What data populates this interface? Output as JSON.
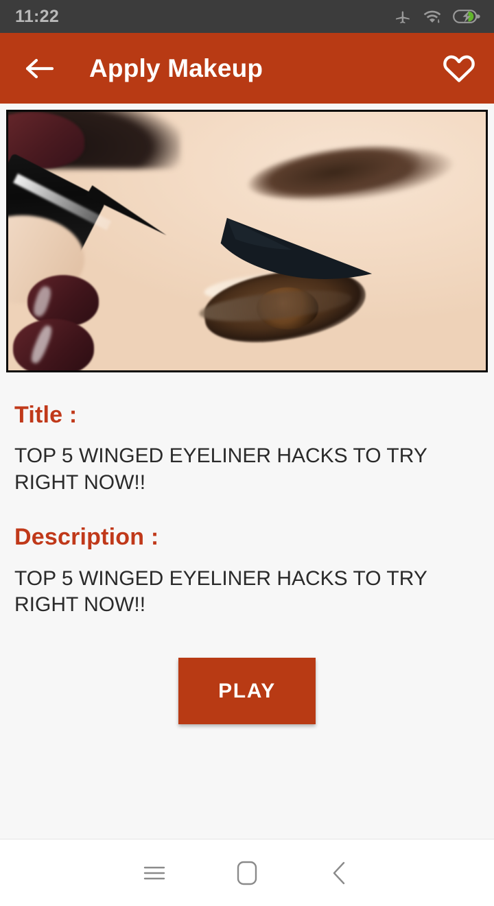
{
  "status_bar": {
    "time": "11:22",
    "icons": [
      {
        "name": "airplane-mode-icon",
        "label": "airplane-mode"
      },
      {
        "name": "wifi-icon",
        "label": "wifi-download"
      },
      {
        "name": "battery-charging-icon",
        "label": "battery-charging"
      }
    ],
    "background_color": "#3c3c3c",
    "text_color": "#b9b9b9"
  },
  "app_bar": {
    "title": "Apply Makeup",
    "back_icon": "arrow-left-icon",
    "favorite_icon": "heart-outline-icon",
    "background_color": "#b83a14",
    "text_color": "#ffffff"
  },
  "hero": {
    "alt": "Close-up of an eye with black winged eyeliner being applied with a liner pen",
    "border_color": "#0a0a0a"
  },
  "details": {
    "title_label": "Title :",
    "title_value": "TOP 5 WINGED EYELINER HACKS TO TRY RIGHT NOW!!",
    "description_label": "Description :",
    "description_value": "TOP 5 WINGED EYELINER HACKS TO TRY RIGHT NOW!!",
    "label_color": "#c0391a",
    "body_color": "#2a2a2a"
  },
  "actions": {
    "play_label": "PLAY",
    "play_background": "#b83a14",
    "play_text_color": "#ffffff"
  },
  "nav_bar": {
    "items": [
      {
        "name": "recents-button",
        "icon": "menu-icon"
      },
      {
        "name": "home-button",
        "icon": "square-rounded-icon"
      },
      {
        "name": "back-button",
        "icon": "chevron-left-icon"
      }
    ],
    "icon_color": "#8a8a8a",
    "background_color": "#ffffff"
  },
  "page": {
    "background_color": "#f7f7f7"
  }
}
